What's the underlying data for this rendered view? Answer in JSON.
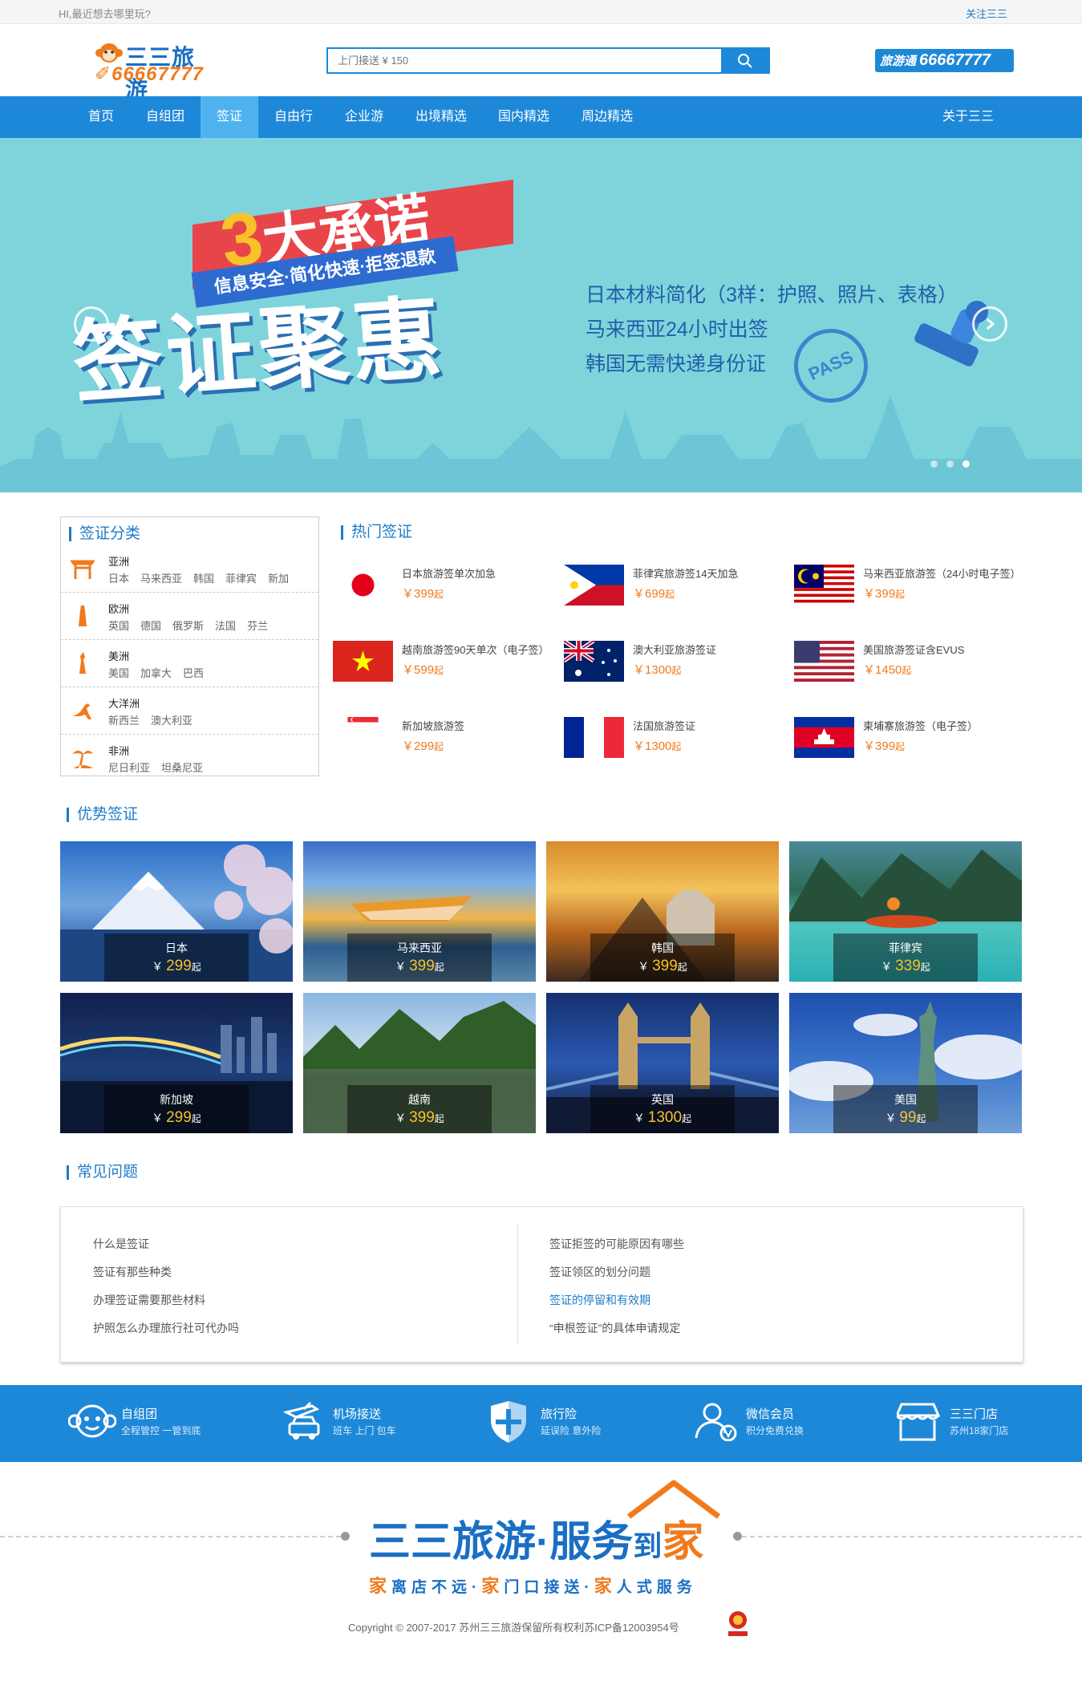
{
  "topbar": {
    "greeting": "HI,最近想去哪里玩?",
    "follow": "关注三三"
  },
  "header": {
    "logo_brand": "三三旅游",
    "logo_phone": "66667777",
    "search_placeholder": "上门接送 ¥ 150",
    "hotline_label": "旅游通",
    "hotline_number": "66667777"
  },
  "nav": {
    "items": [
      "首页",
      "自组团",
      "签证",
      "自由行",
      "企业游",
      "出境精选",
      "国内精选",
      "周边精选"
    ],
    "active": "签证",
    "right": "关于三三"
  },
  "banner": {
    "promise_number": "3",
    "promise_text": "大承诺",
    "promise_sub": "信息安全·简化快速·拒签退款",
    "title": "签证聚惠",
    "benefits": [
      "日本材料简化（3样：护照、照片、表格）",
      "马来西亚24小时出签",
      "韩国无需快递身份证"
    ],
    "stamp": "PASS",
    "active_slide": 3,
    "slide_count": 3
  },
  "categories": {
    "title": "签证分类",
    "rows": [
      {
        "name": "亚洲",
        "icon": "asia-gate-icon",
        "countries": [
          "日本",
          "马来西亚",
          "韩国",
          "菲律宾",
          "新加"
        ]
      },
      {
        "name": "欧洲",
        "icon": "europe-tower-icon",
        "countries": [
          "英国",
          "德国",
          "俄罗斯",
          "法国",
          "芬兰"
        ]
      },
      {
        "name": "美洲",
        "icon": "statue-of-liberty-icon",
        "countries": [
          "美国",
          "加拿大",
          "巴西"
        ]
      },
      {
        "name": "大洋洲",
        "icon": "kangaroo-icon",
        "countries": [
          "新西兰",
          "澳大利亚"
        ]
      },
      {
        "name": "非洲",
        "icon": "africa-palm-icon",
        "countries": [
          "尼日利亚",
          "坦桑尼亚"
        ]
      }
    ]
  },
  "hot_visas": {
    "title": "热门签证",
    "currency": "￥",
    "suffix": "起",
    "items": [
      {
        "name": "日本旅游签单次加急",
        "price": "399",
        "flag": "japan-flag"
      },
      {
        "name": "菲律宾旅游签14天加急",
        "price": "699",
        "flag": "philippines-flag"
      },
      {
        "name": "马来西亚旅游签（24小时电子签）",
        "price": "399",
        "flag": "malaysia-flag"
      },
      {
        "name": "越南旅游签90天单次（电子签）",
        "price": "599",
        "flag": "vietnam-flag"
      },
      {
        "name": "澳大利亚旅游签证",
        "price": "1300",
        "flag": "australia-flag"
      },
      {
        "name": "美国旅游签证含EVUS",
        "price": "1450",
        "flag": "usa-flag"
      },
      {
        "name": "新加坡旅游签",
        "price": "299",
        "flag": "singapore-flag"
      },
      {
        "name": "法国旅游签证",
        "price": "1300",
        "flag": "france-flag"
      },
      {
        "name": "柬埔寨旅游签（电子签）",
        "price": "399",
        "flag": "cambodia-flag"
      }
    ]
  },
  "featured": {
    "title": "优势签证",
    "currency": "￥",
    "suffix": "起",
    "items": [
      {
        "name": "日本",
        "price": "299"
      },
      {
        "name": "马来西亚",
        "price": "399"
      },
      {
        "name": "韩国",
        "price": "399"
      },
      {
        "name": "菲律宾",
        "price": "339"
      },
      {
        "name": "新加坡",
        "price": "299"
      },
      {
        "name": "越南",
        "price": "399"
      },
      {
        "name": "英国",
        "price": "1300"
      },
      {
        "name": "美国",
        "price": "99"
      }
    ]
  },
  "faq": {
    "title": "常见问题",
    "left": [
      "什么是签证",
      "签证有那些种类",
      "办理签证需要那些材料",
      "护照怎么办理旅行社可代办吗"
    ],
    "right": [
      "签证拒签的可能原因有哪些",
      "签证领区的划分问题",
      "签证的停留和有效期",
      "“申根签证”的具体申请规定"
    ],
    "highlighted": "签证的停留和有效期"
  },
  "features": [
    {
      "title": "自组团",
      "sub": "全程管控 一管到底",
      "icon": "monkey-icon"
    },
    {
      "title": "机场接送",
      "sub": "班车 上门 包车",
      "icon": "plane-car-icon"
    },
    {
      "title": "旅行险",
      "sub": "延误险 意外险",
      "icon": "shield-icon"
    },
    {
      "title": "微信会员",
      "sub": "积分免费兑换",
      "icon": "member-icon"
    },
    {
      "title": "三三门店",
      "sub": "苏州18家门店",
      "icon": "store-icon"
    }
  ],
  "footer": {
    "brand": "三三旅游",
    "dot": "·",
    "service": "服务",
    "to": "到",
    "home": "家",
    "slogan": [
      "家",
      "离店不远·",
      "家",
      "门口接送·",
      "家",
      "人式服务"
    ],
    "copyright": "Copyright © 2007-2017 苏州三三旅游保留所有权利苏ICP备12003954号"
  },
  "colors": {
    "primary": "#1e88d8",
    "nav_active": "#4fb2f0",
    "accent": "#f07a1c",
    "price_yellow": "#f7c22a",
    "banner_bg": "#7fd4dc"
  }
}
